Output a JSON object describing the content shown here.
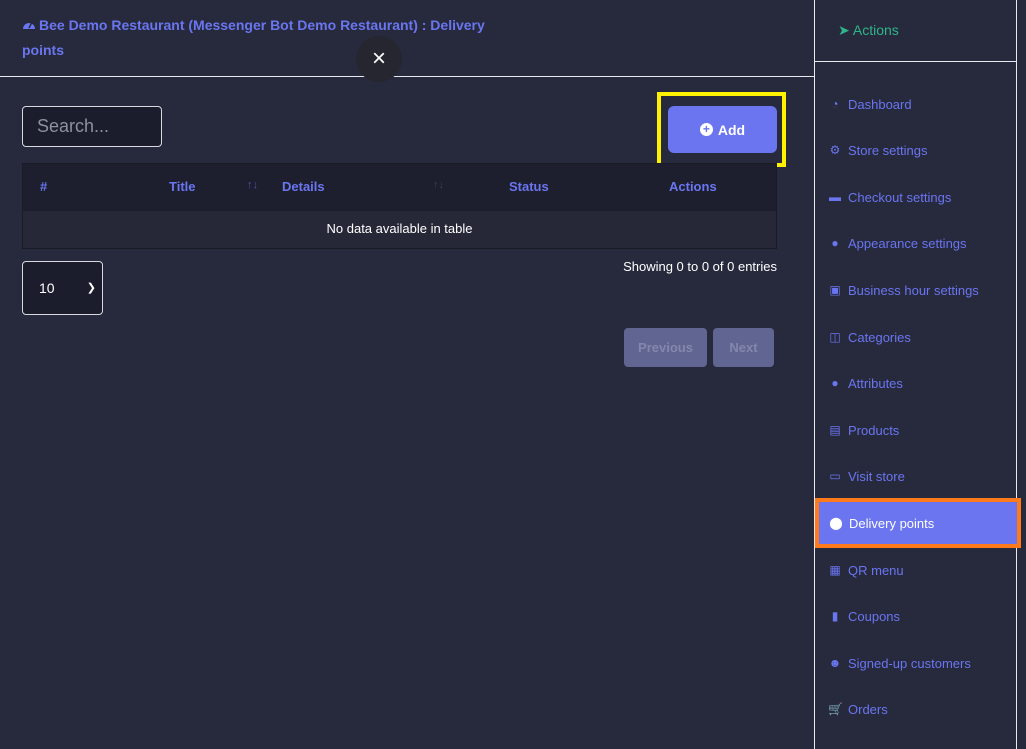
{
  "header": {
    "title": "Bee Demo Restaurant (Messenger Bot Demo Restaurant) : Delivery points",
    "title_icon": "tachometer-icon",
    "close_label": "×"
  },
  "search": {
    "placeholder": "Search..."
  },
  "add_button": {
    "label": "Add",
    "icon": "plus-circle-icon"
  },
  "table": {
    "columns": [
      "#",
      "Title",
      "Details",
      "Status",
      "Actions"
    ],
    "sort_glyph": "↑↓",
    "empty_message": "No data available in table"
  },
  "length_select": {
    "value": "10"
  },
  "info": "Showing 0 to 0 of 0 entries",
  "pagination": {
    "previous": "Previous",
    "next": "Next"
  },
  "sidebar": {
    "header": "Actions",
    "items": [
      {
        "label": "Dashboard",
        "icon": "tachometer-icon",
        "glyph": "◔"
      },
      {
        "label": "Store settings",
        "icon": "gear-icon",
        "glyph": "⚙"
      },
      {
        "label": "Checkout settings",
        "icon": "credit-card-icon",
        "glyph": "▬"
      },
      {
        "label": "Appearance settings",
        "icon": "palette-icon",
        "glyph": "●"
      },
      {
        "label": "Business hour settings",
        "icon": "calendar-check-icon",
        "glyph": "▣"
      },
      {
        "label": "Categories",
        "icon": "columns-icon",
        "glyph": "◫"
      },
      {
        "label": "Attributes",
        "icon": "palette-icon",
        "glyph": "●"
      },
      {
        "label": "Products",
        "icon": "boxes-icon",
        "glyph": "▤"
      },
      {
        "label": "Visit store",
        "icon": "store-icon",
        "glyph": "▭"
      },
      {
        "label": "Delivery points",
        "icon": "map-marker-icon",
        "glyph": "⬤",
        "active": true
      },
      {
        "label": "QR menu",
        "icon": "qrcode-icon",
        "glyph": "▦"
      },
      {
        "label": "Coupons",
        "icon": "ticket-icon",
        "glyph": "▮"
      },
      {
        "label": "Signed-up customers",
        "icon": "users-icon",
        "glyph": "☻"
      },
      {
        "label": "Orders",
        "icon": "cart-icon",
        "glyph": "🛒"
      }
    ]
  },
  "colors": {
    "accent": "#6a75ef",
    "highlight_add": "#fff200",
    "highlight_active": "#ff7a1a",
    "actions_green": "#2fb58a",
    "background": "#272a3d"
  }
}
